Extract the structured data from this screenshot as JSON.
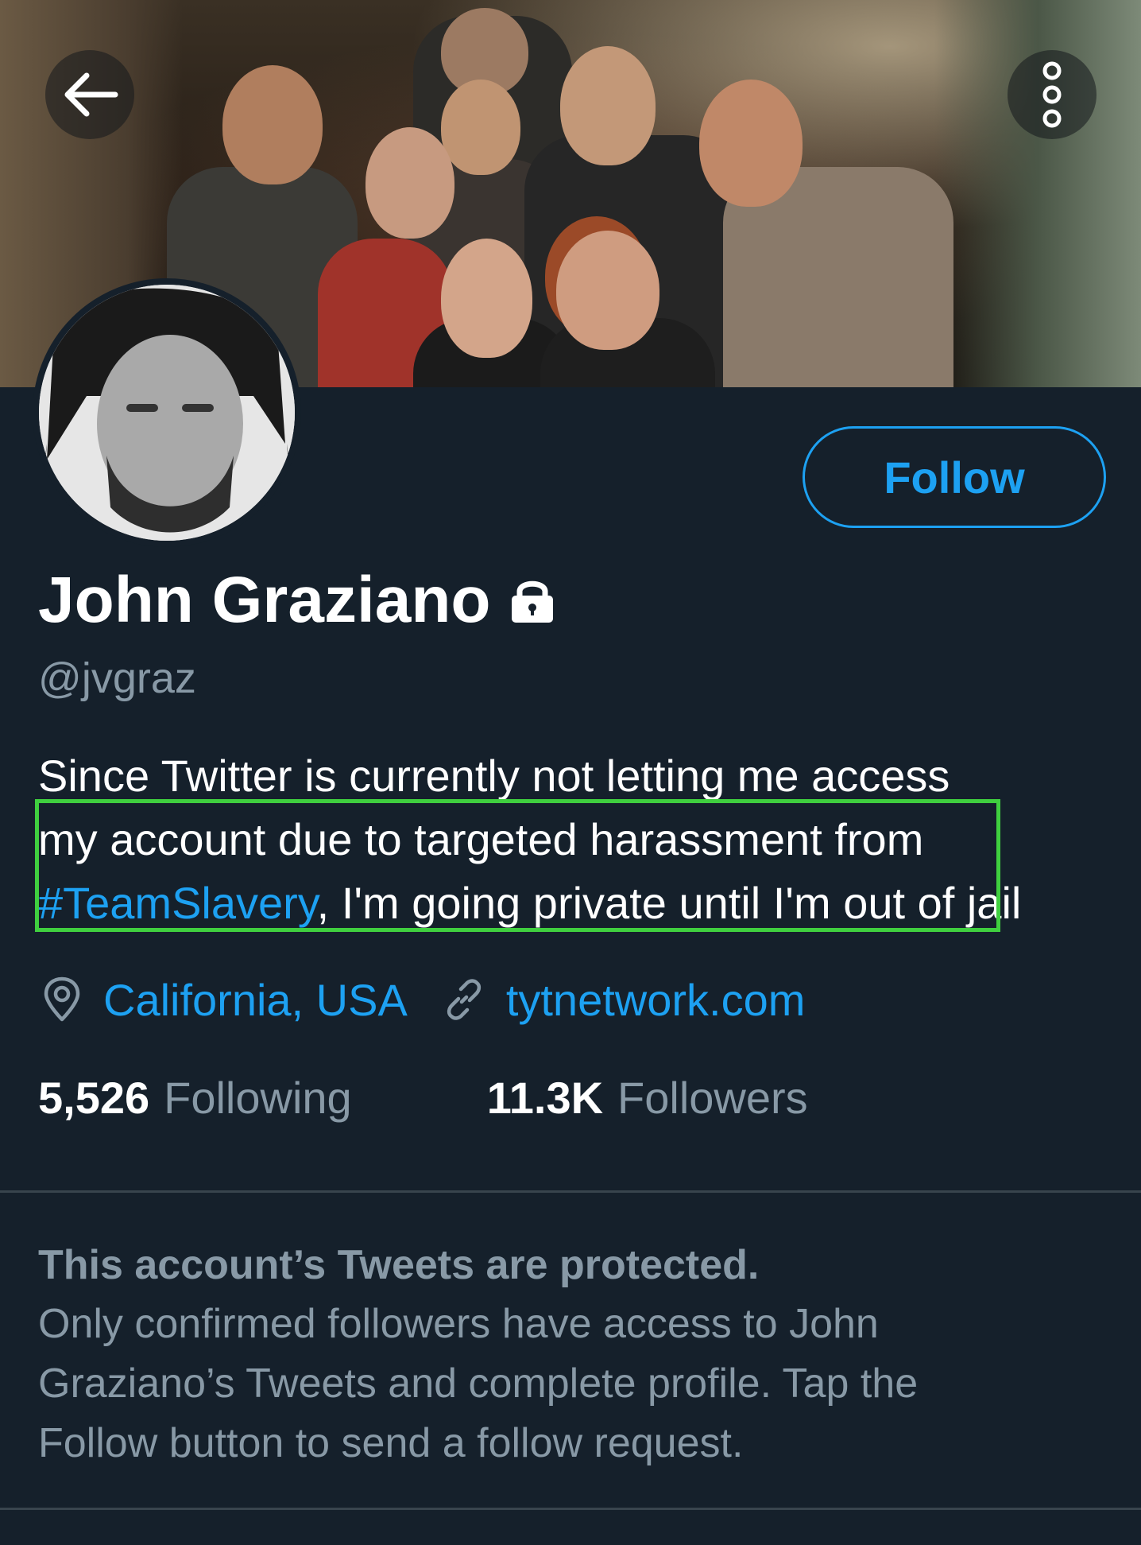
{
  "header": {
    "back_icon": "arrow-left-icon",
    "more_icon": "vertical-ellipsis-icon",
    "banner_description": "group photo banner"
  },
  "profile": {
    "name": "John Graziano",
    "lock_icon": "lock-icon",
    "handle": "@jvgraz",
    "follow_label": "Follow",
    "bio": {
      "line1": "Since Twitter is currently not letting me access",
      "line2": "my account due to targeted harassment from",
      "hashtag": "#TeamSlavery",
      "line3_rest": ", I'm going private until I'm out of jail"
    },
    "location": {
      "icon": "location-pin-icon",
      "text": "California, USA"
    },
    "website": {
      "icon": "link-icon",
      "text": "tytnetwork.com"
    },
    "stats": {
      "following_count": "5,526",
      "following_label": "Following",
      "followers_count": "11.3K",
      "followers_label": "Followers"
    }
  },
  "protected": {
    "title": "This account’s Tweets are protected.",
    "line1": "Only confirmed followers have access to John",
    "line2": "Graziano’s Tweets and complete profile. Tap the",
    "line3": "Follow button to send a follow request."
  },
  "colors": {
    "background": "#15202b",
    "accent": "#1da1f2",
    "secondary_text": "#8899a6",
    "highlight": "#3fcf3f"
  }
}
